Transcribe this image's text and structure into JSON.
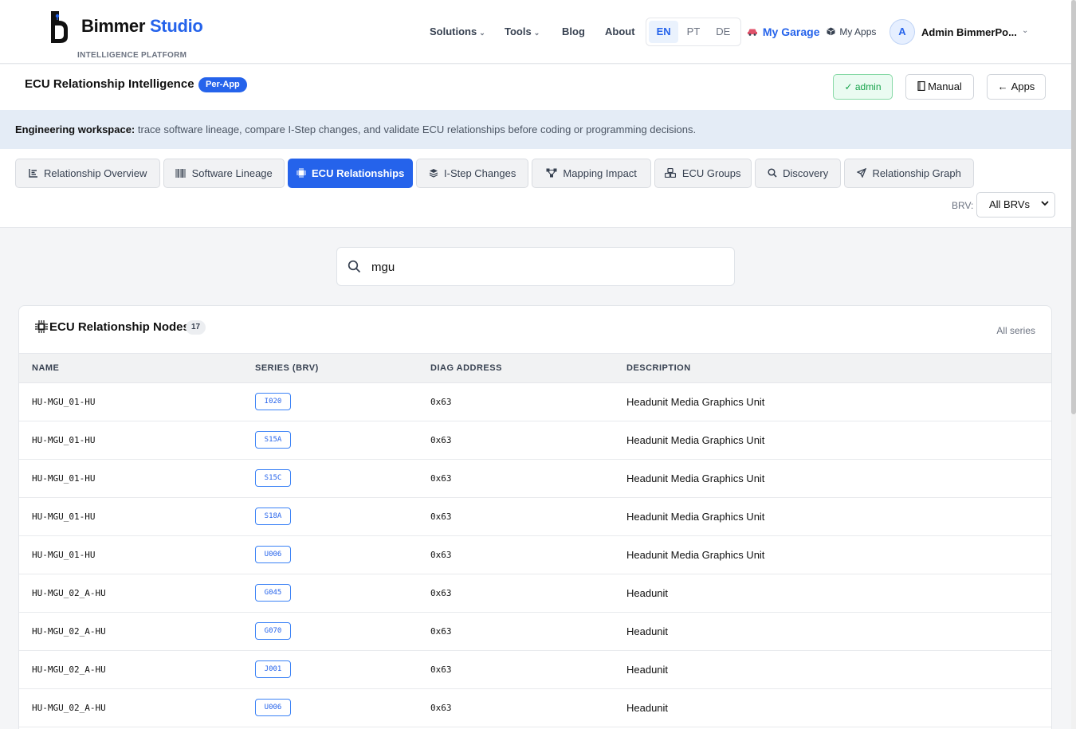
{
  "header": {
    "brand_main": "Bimmer",
    "brand_accent": "Studio",
    "brand_sub": "INTELLIGENCE PLATFORM",
    "nav": {
      "solutions": "Solutions",
      "tools": "Tools",
      "blog": "Blog",
      "about": "About"
    },
    "languages": [
      "EN",
      "PT",
      "DE"
    ],
    "active_language": "EN",
    "garage": "My Garage",
    "my_apps": "My Apps",
    "avatar_initial": "A",
    "user_name": "Admin BimmerPo..."
  },
  "page": {
    "title": "ECU Relationship Intelligence",
    "badge": "Per-App",
    "admin_button": "✓ admin",
    "manual_button": "Manual",
    "apps_button": "Apps"
  },
  "banner": {
    "label": "Engineering workspace:",
    "text": " trace software lineage, compare I-Step changes, and validate ECU relationships before coding or programming decisions."
  },
  "tabs": [
    {
      "label": "Relationship Overview",
      "icon": "chart-icon"
    },
    {
      "label": "Software Lineage",
      "icon": "barcode-icon"
    },
    {
      "label": "ECU Relationships",
      "icon": "chip-icon",
      "active": true
    },
    {
      "label": "I-Step Changes",
      "icon": "layers-icon"
    },
    {
      "label": "Mapping Impact",
      "icon": "nodes-icon"
    },
    {
      "label": "ECU Groups",
      "icon": "cubes-icon"
    },
    {
      "label": "Discovery",
      "icon": "search-icon"
    },
    {
      "label": "Relationship Graph",
      "icon": "send-icon"
    }
  ],
  "filter": {
    "brv_label": "BRV:",
    "brv_value": "All BRVs"
  },
  "search": {
    "value": "mgu"
  },
  "table": {
    "title": "ECU Relationship Nodes",
    "count": "17",
    "scope": "All series",
    "columns": [
      "NAME",
      "SERIES (BRV)",
      "DIAG ADDRESS",
      "DESCRIPTION"
    ],
    "rows": [
      {
        "name": "HU-MGU_01-HU",
        "series": "I020",
        "diag": "0x63",
        "description": "Headunit Media Graphics Unit"
      },
      {
        "name": "HU-MGU_01-HU",
        "series": "S15A",
        "diag": "0x63",
        "description": "Headunit Media Graphics Unit"
      },
      {
        "name": "HU-MGU_01-HU",
        "series": "S15C",
        "diag": "0x63",
        "description": "Headunit Media Graphics Unit"
      },
      {
        "name": "HU-MGU_01-HU",
        "series": "S18A",
        "diag": "0x63",
        "description": "Headunit Media Graphics Unit"
      },
      {
        "name": "HU-MGU_01-HU",
        "series": "U006",
        "diag": "0x63",
        "description": "Headunit Media Graphics Unit"
      },
      {
        "name": "HU-MGU_02_A-HU",
        "series": "G045",
        "diag": "0x63",
        "description": "Headunit"
      },
      {
        "name": "HU-MGU_02_A-HU",
        "series": "G070",
        "diag": "0x63",
        "description": "Headunit"
      },
      {
        "name": "HU-MGU_02_A-HU",
        "series": "J001",
        "diag": "0x63",
        "description": "Headunit"
      },
      {
        "name": "HU-MGU_02_A-HU",
        "series": "U006",
        "diag": "0x63",
        "description": "Headunit"
      }
    ]
  },
  "colors": {
    "accent": "#2563eb",
    "success": "#16a34a",
    "banner_bg": "#e4ecf6"
  }
}
